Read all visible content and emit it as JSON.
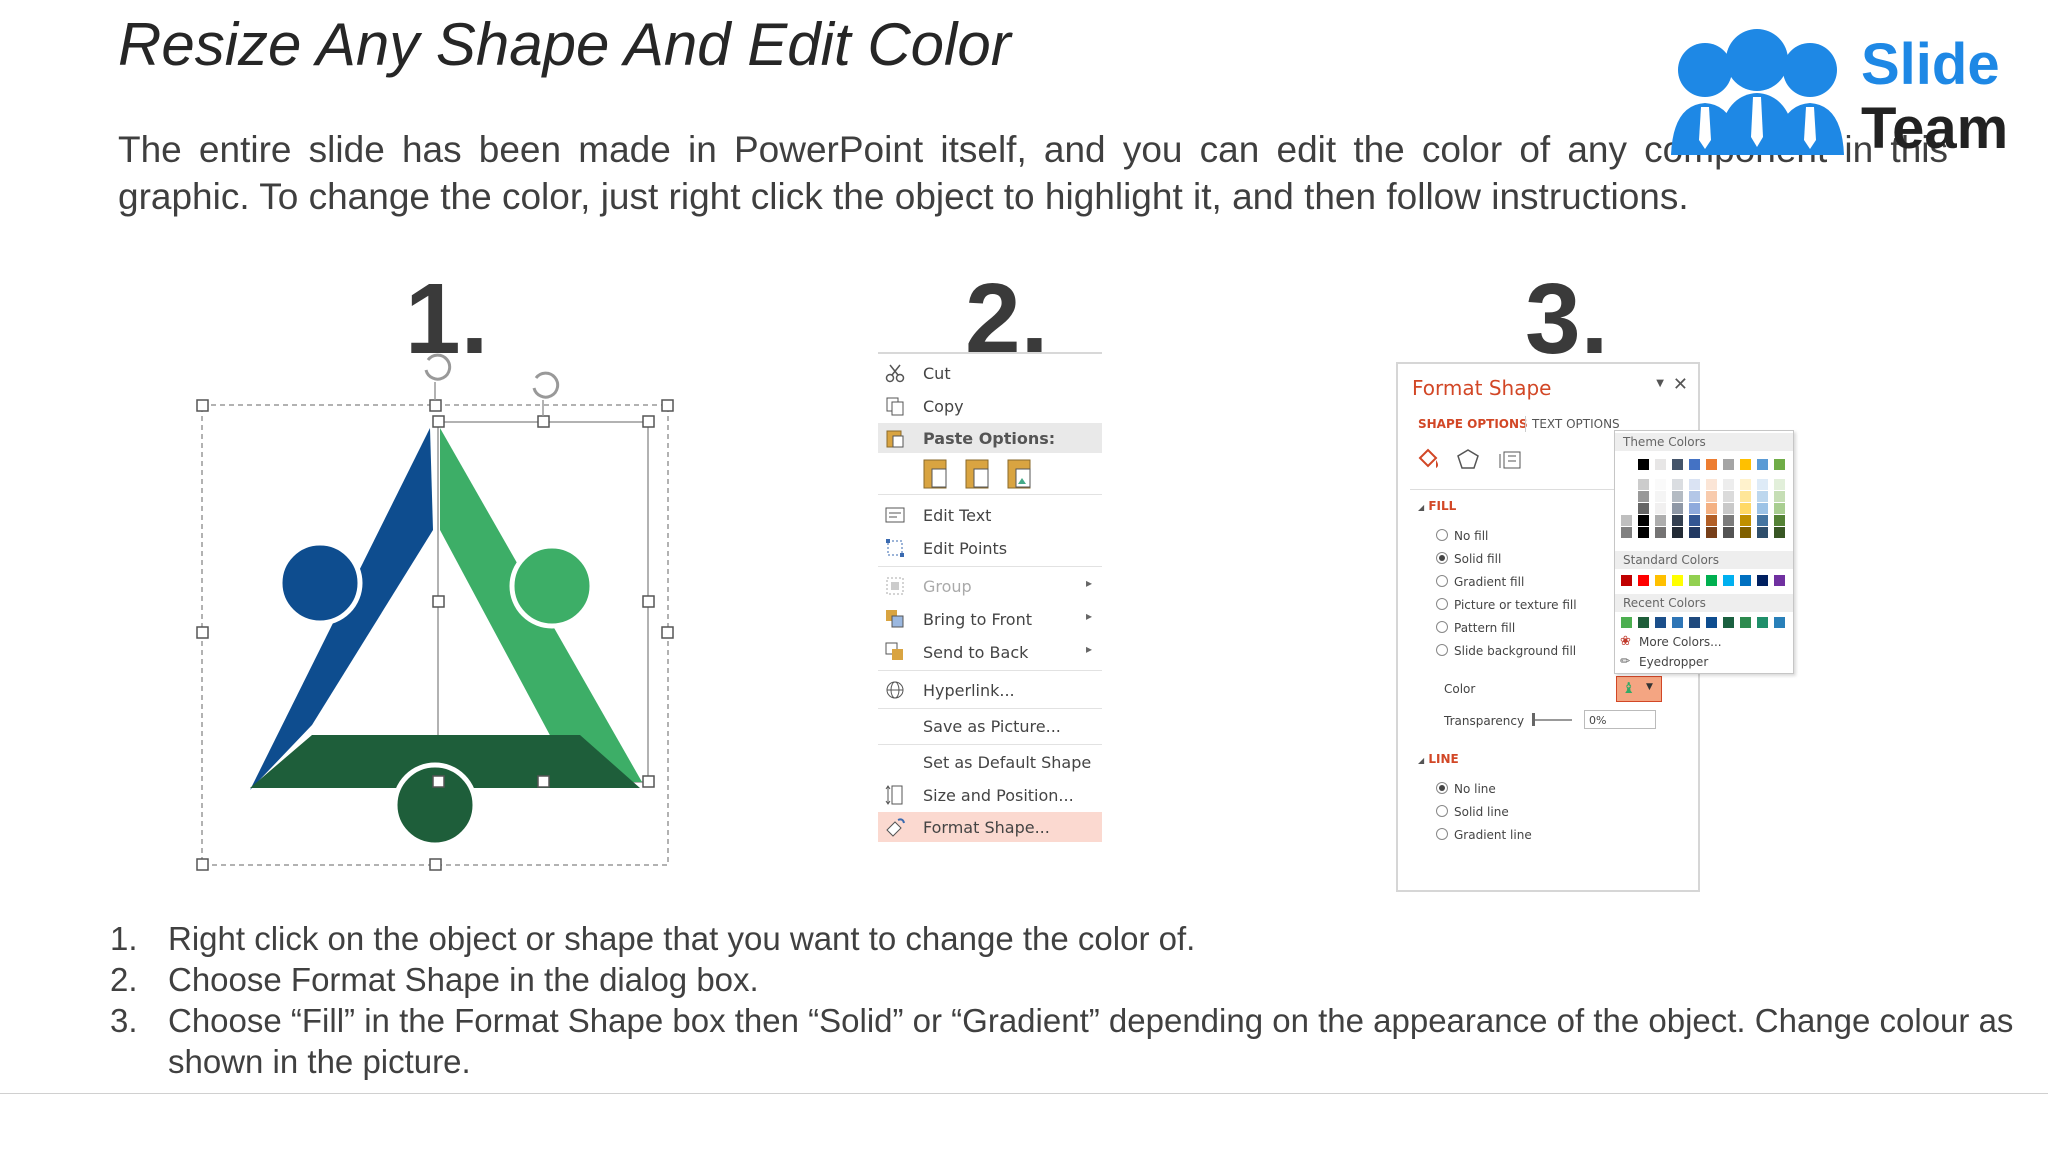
{
  "title": "Resize Any Shape And Edit Color",
  "intro": "The entire slide has been made in PowerPoint itself, and you can edit the color of any component in this graphic. To change the color, just right click the object to highlight it, and then follow instructions.",
  "logo": {
    "line1": "Slide",
    "line2": "Team"
  },
  "step_numbers": [
    "1.",
    "2.",
    "3."
  ],
  "context_menu": {
    "items": [
      {
        "label": "Cut",
        "icon": "scissors-icon"
      },
      {
        "label": "Copy",
        "icon": "copy-icon"
      },
      {
        "label": "Paste Options:",
        "icon": "paste-icon"
      },
      {
        "label": "Edit Text",
        "icon": "edit-text-icon"
      },
      {
        "label": "Edit Points",
        "icon": "edit-points-icon"
      },
      {
        "label": "Group",
        "icon": "group-icon",
        "disabled": true
      },
      {
        "label": "Bring to Front",
        "icon": "bring-front-icon"
      },
      {
        "label": "Send to Back",
        "icon": "send-back-icon"
      },
      {
        "label": "Hyperlink...",
        "icon": "hyperlink-icon"
      },
      {
        "label": "Save as Picture...",
        "icon": ""
      },
      {
        "label": "Set as Default Shape",
        "icon": ""
      },
      {
        "label": "Size and Position...",
        "icon": "size-position-icon"
      },
      {
        "label": "Format Shape...",
        "icon": "format-shape-icon",
        "highlighted": true
      }
    ]
  },
  "format_pane": {
    "title": "Format Shape",
    "tab_shape": "SHAPE OPTIONS",
    "tab_text": "TEXT OPTIONS",
    "fill_header": "FILL",
    "fill_options": [
      "No fill",
      "Solid fill",
      "Gradient fill",
      "Picture or texture fill",
      "Pattern fill",
      "Slide background fill"
    ],
    "fill_selected": "Solid fill",
    "color_label": "Color",
    "transparency_label": "Transparency",
    "transparency_value": "0%",
    "line_header": "LINE",
    "line_options": [
      "No line",
      "Solid line",
      "Gradient line"
    ],
    "line_selected": "No line"
  },
  "palette": {
    "theme_header": "Theme Colors",
    "standard_header": "Standard Colors",
    "recent_header": "Recent Colors",
    "more_colors": "More Colors...",
    "eyedropper": "Eyedropper",
    "theme_top": [
      "#ffffff",
      "#000000",
      "#e7e6e6",
      "#44546a",
      "#4472c4",
      "#ed7d31",
      "#a5a5a5",
      "#ffc000",
      "#5b9bd5",
      "#70ad47"
    ],
    "standard": [
      "#c00000",
      "#ff0000",
      "#ffc000",
      "#ffff00",
      "#92d050",
      "#00b050",
      "#00b0f0",
      "#0070c0",
      "#002060",
      "#7030a0"
    ],
    "recent": [
      "#4caf50",
      "#1e5e3a",
      "#1b4f8a",
      "#2e75b6",
      "#1f497d",
      "#0e4d8f",
      "#1a6040",
      "#2d8a4e",
      "#1f8f6a",
      "#2980b9"
    ]
  },
  "instructions": [
    "Right click on the object or shape that you want to change the color of.",
    "Choose Format Shape in the dialog box.",
    "Choose “Fill” in the Format Shape box then “Solid” or “Gradient” depending on the appearance of the object. Change colour as shown in the picture."
  ],
  "instruction_numbers": [
    "1.",
    "2.",
    "3."
  ]
}
